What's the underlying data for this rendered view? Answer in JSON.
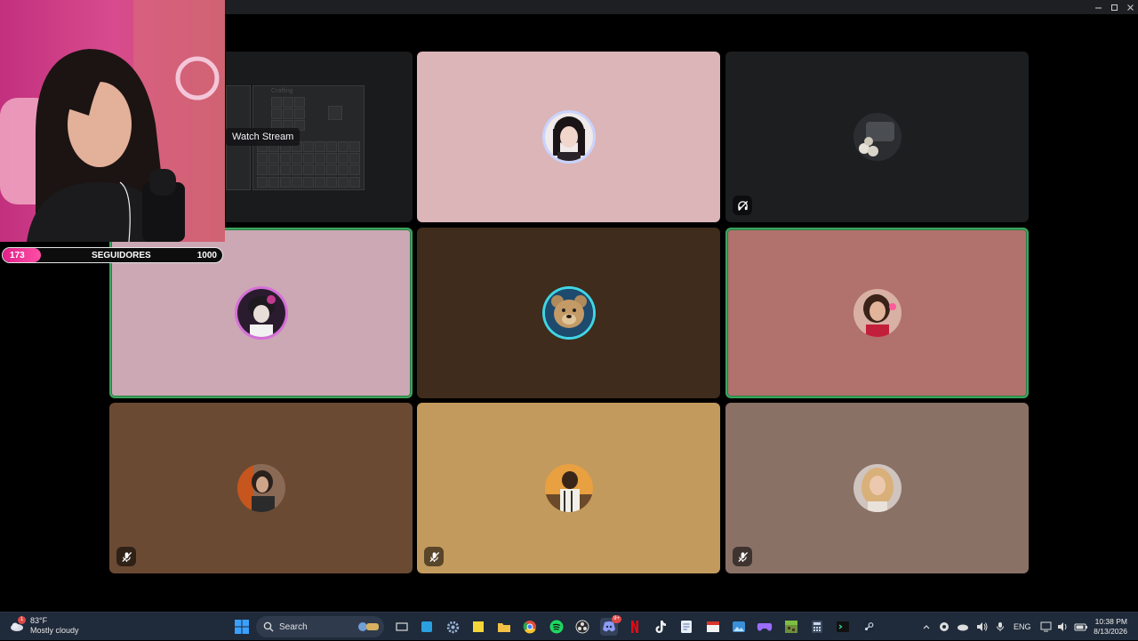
{
  "window": {
    "controls": [
      "minimize",
      "maximize",
      "close"
    ]
  },
  "stream_preview": {
    "watch_label": "Watch Stream",
    "inventory_title": "Crafting"
  },
  "tiles": [
    {
      "id": "t1",
      "bg": "#dcb5b8",
      "speaking": false,
      "badge": null,
      "avatar": "girl-dark-hair"
    },
    {
      "id": "t2",
      "bg": "#1c1e20",
      "speaking": false,
      "badge": "deafened",
      "avatar": "skulls-car"
    },
    {
      "id": "t3",
      "bg": "#cba8b4",
      "speaking": true,
      "badge": null,
      "avatar": "anime-boy"
    },
    {
      "id": "t4",
      "bg": "#3f2c1c",
      "speaking": false,
      "badge": null,
      "avatar": "teddy-bear"
    },
    {
      "id": "t5",
      "bg": "#b1716c",
      "speaking": true,
      "badge": null,
      "avatar": "woman-red-top"
    },
    {
      "id": "t6",
      "bg": "#6b4a33",
      "speaking": false,
      "badge": "muted",
      "avatar": "mirror-selfie"
    },
    {
      "id": "t7",
      "bg": "#c39a5d",
      "speaking": false,
      "badge": "muted",
      "avatar": "man-sunset"
    },
    {
      "id": "t8",
      "bg": "#8a7166",
      "speaking": false,
      "badge": "muted",
      "avatar": "blonde-woman"
    }
  ],
  "follower_goal": {
    "current": "173",
    "label": "SEGUIDORES",
    "goal": "1000",
    "progress": 0.173
  },
  "taskbar": {
    "weather": {
      "temp": "83°F",
      "condition": "Mostly cloudy",
      "alert_count": "1"
    },
    "search_placeholder": "Search",
    "apps": [
      "windows-start",
      "file-explorer-widget",
      "task-view",
      "store",
      "settings",
      "sticky-notes",
      "folder",
      "chrome",
      "spotify",
      "obs",
      "discord",
      "netflix",
      "tiktok",
      "notepad",
      "news",
      "photos",
      "game-controller",
      "minecraft",
      "calculator",
      "terminal",
      "steam"
    ],
    "discord_badge": "9+",
    "language": "ENG",
    "time": "10:38 PM",
    "date": "8/13/2026"
  },
  "colors": {
    "speaking": "#3ba55d",
    "taskbar": "#1f2a3a",
    "follow_fill": "#e0208a"
  }
}
